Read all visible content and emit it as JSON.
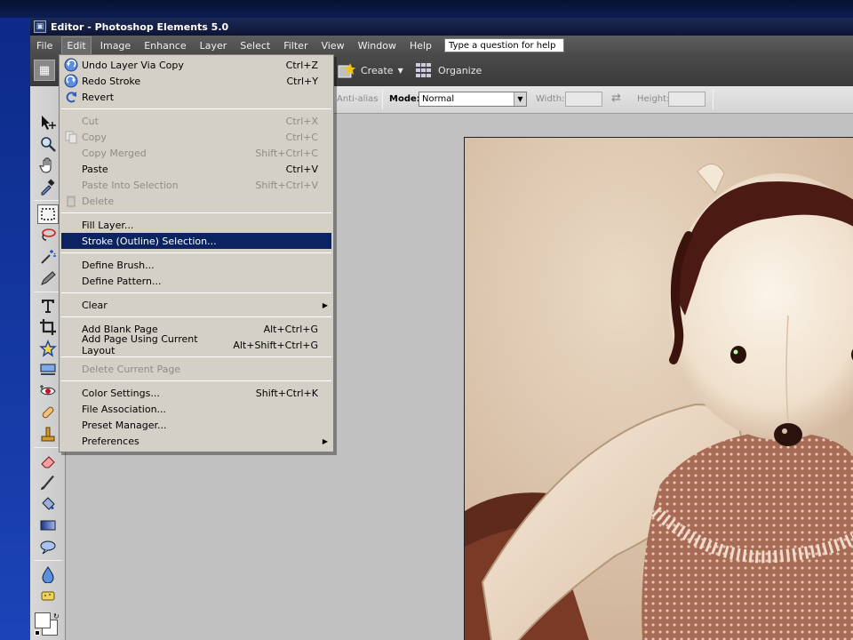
{
  "app": {
    "title": "Editor - Photoshop Elements 5.0"
  },
  "menubar": {
    "items": [
      "File",
      "Edit",
      "Image",
      "Enhance",
      "Layer",
      "Select",
      "Filter",
      "View",
      "Window",
      "Help"
    ],
    "active": "Edit",
    "question_placeholder": "Type a question for help"
  },
  "shortcuts": {
    "create_label": "Create",
    "organize_label": "Organize"
  },
  "options": {
    "antialias_label": "Anti-alias",
    "mode_label": "Mode:",
    "mode_value": "Normal",
    "width_label": "Width:",
    "height_label": "Height:"
  },
  "edit_menu": {
    "groups": [
      [
        {
          "label": "Undo Layer Via Copy",
          "shortcut": "Ctrl+Z",
          "icon": "undo-icon",
          "enabled": true
        },
        {
          "label": "Redo Stroke",
          "shortcut": "Ctrl+Y",
          "icon": "redo-icon",
          "enabled": true
        },
        {
          "label": "Revert",
          "shortcut": "",
          "icon": "revert-icon",
          "enabled": true
        }
      ],
      [
        {
          "label": "Cut",
          "shortcut": "Ctrl+X",
          "icon": "",
          "enabled": false
        },
        {
          "label": "Copy",
          "shortcut": "Ctrl+C",
          "icon": "copy-icon",
          "enabled": false
        },
        {
          "label": "Copy Merged",
          "shortcut": "Shift+Ctrl+C",
          "icon": "",
          "enabled": false
        },
        {
          "label": "Paste",
          "shortcut": "Ctrl+V",
          "icon": "",
          "enabled": true
        },
        {
          "label": "Paste Into Selection",
          "shortcut": "Shift+Ctrl+V",
          "icon": "",
          "enabled": false
        },
        {
          "label": "Delete",
          "shortcut": "",
          "icon": "trash-icon",
          "enabled": false
        }
      ],
      [
        {
          "label": "Fill Layer...",
          "shortcut": "",
          "icon": "",
          "enabled": true
        },
        {
          "label": "Stroke (Outline) Selection...",
          "shortcut": "",
          "icon": "",
          "enabled": true,
          "highlighted": true
        }
      ],
      [
        {
          "label": "Define Brush...",
          "shortcut": "",
          "icon": "",
          "enabled": true
        },
        {
          "label": "Define Pattern...",
          "shortcut": "",
          "icon": "",
          "enabled": true
        }
      ],
      [
        {
          "label": "Clear",
          "shortcut": "",
          "icon": "",
          "enabled": true,
          "submenu": true
        }
      ],
      [
        {
          "label": "Add Blank Page",
          "shortcut": "Alt+Ctrl+G",
          "icon": "",
          "enabled": true
        },
        {
          "label": "Add Page Using Current Layout",
          "shortcut": "Alt+Shift+Ctrl+G",
          "icon": "",
          "enabled": true
        }
      ],
      [
        {
          "label": "Delete Current Page",
          "shortcut": "",
          "icon": "",
          "enabled": false
        }
      ],
      [
        {
          "label": "Color Settings...",
          "shortcut": "Shift+Ctrl+K",
          "icon": "",
          "enabled": true
        },
        {
          "label": "File Association...",
          "shortcut": "",
          "icon": "",
          "enabled": true
        },
        {
          "label": "Preset Manager...",
          "shortcut": "",
          "icon": "",
          "enabled": true
        },
        {
          "label": "Preferences",
          "shortcut": "",
          "icon": "",
          "enabled": true,
          "submenu": true
        }
      ]
    ]
  },
  "colors": {
    "highlight": "#0b2361",
    "menu_bg": "#d4d0c8",
    "workspace": "#c1c1c1"
  }
}
